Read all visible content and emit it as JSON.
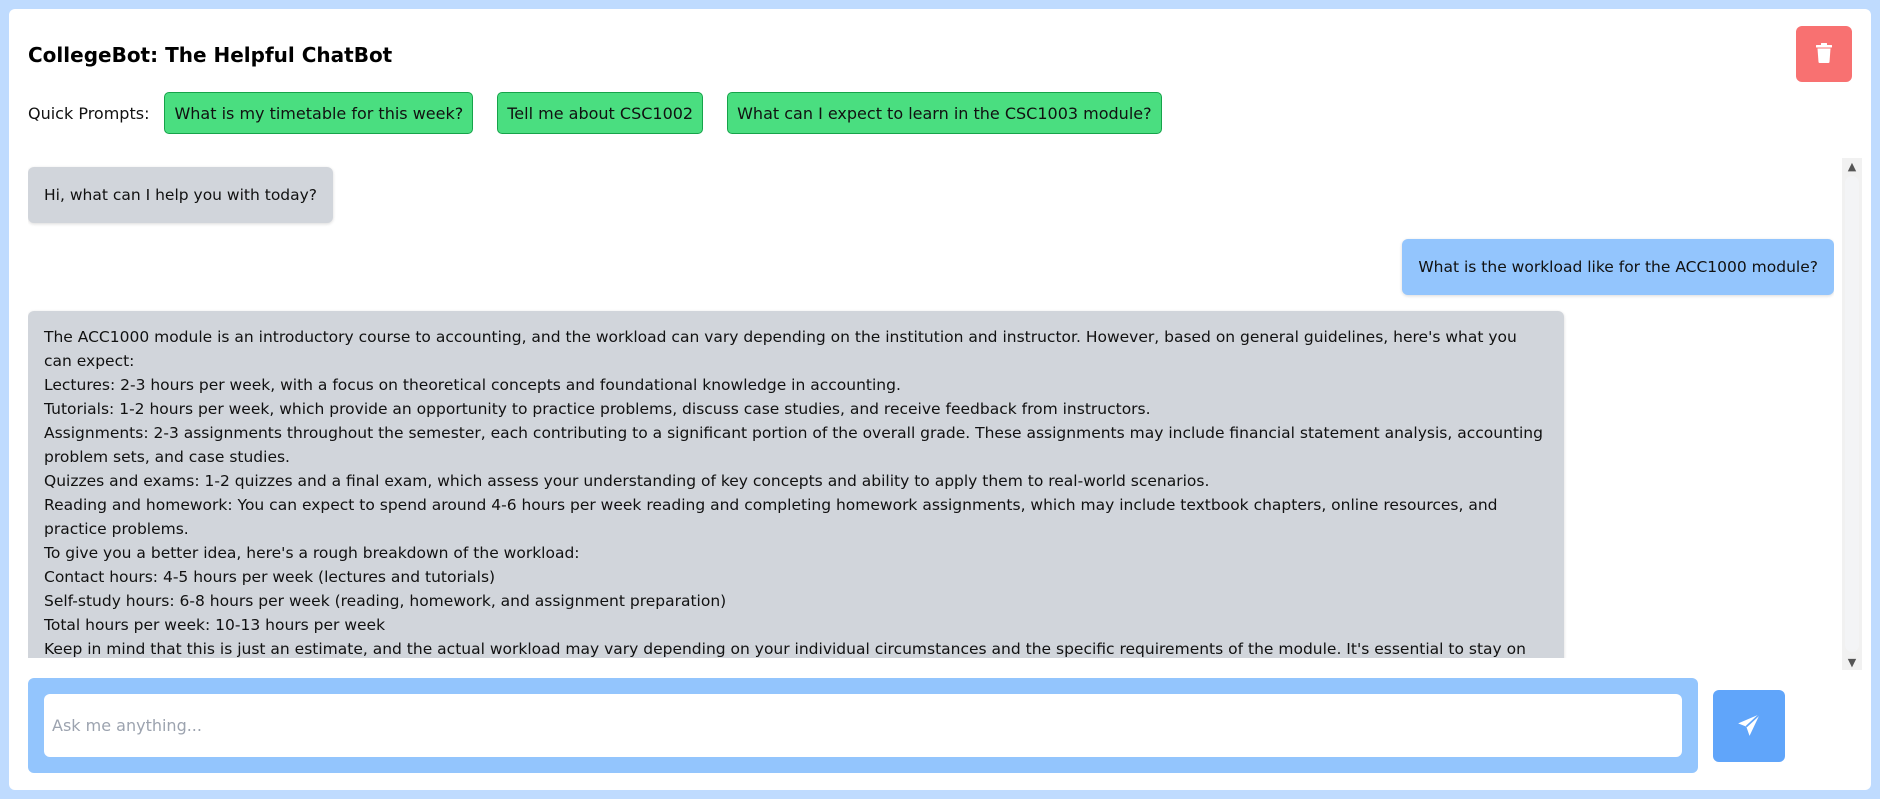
{
  "app": {
    "title": "CollegeBot: The Helpful ChatBot"
  },
  "quick_prompts": {
    "label": "Quick Prompts:",
    "items": [
      "What is my timetable for this week?",
      "Tell me about CSC1002",
      "What can I expect to learn in the CSC1003 module?"
    ]
  },
  "messages": [
    {
      "role": "bot",
      "lines": [
        "Hi, what can I help you with today?"
      ]
    },
    {
      "role": "user",
      "lines": [
        "What is the workload like for the ACC1000 module?"
      ]
    },
    {
      "role": "bot",
      "lines": [
        "The ACC1000 module is an introductory course to accounting, and the workload can vary depending on the institution and instructor. However, based on general guidelines, here's what you can expect:",
        "Lectures: 2-3 hours per week, with a focus on theoretical concepts and foundational knowledge in accounting.",
        "Tutorials: 1-2 hours per week, which provide an opportunity to practice problems, discuss case studies, and receive feedback from instructors.",
        "Assignments: 2-3 assignments throughout the semester, each contributing to a significant portion of the overall grade. These assignments may include financial statement analysis, accounting problem sets, and case studies.",
        "Quizzes and exams: 1-2 quizzes and a final exam, which assess your understanding of key concepts and ability to apply them to real-world scenarios.",
        "Reading and homework: You can expect to spend around 4-6 hours per week reading and completing homework assignments, which may include textbook chapters, online resources, and practice problems.",
        "To give you a better idea, here's a rough breakdown of the workload:",
        "Contact hours: 4-5 hours per week (lectures and tutorials)",
        "Self-study hours: 6-8 hours per week (reading, homework, and assignment preparation)",
        "Total hours per week: 10-13 hours per week",
        "Keep in mind that this is just an estimate, and the actual workload may vary depending on your individual circumstances and the specific requirements of the module. It's essential to stay on top of your coursework, attend lectures and tutorials regularly, and seek help when needed to ensure you're meeting the demands of the module."
      ]
    }
  ],
  "input": {
    "value": "",
    "placeholder": "Ask me anything..."
  },
  "icons": {
    "clear": "trash-icon",
    "send": "send-icon",
    "scroll_up": "chevron-up-icon",
    "scroll_down": "chevron-down-icon"
  },
  "colors": {
    "background": "#bfdbfe",
    "clear_button": "#f87171",
    "prompt_button": "#4ade80",
    "bot_bubble": "#d1d5db",
    "user_bubble": "#93c5fd",
    "send_button": "#60a5fa"
  }
}
